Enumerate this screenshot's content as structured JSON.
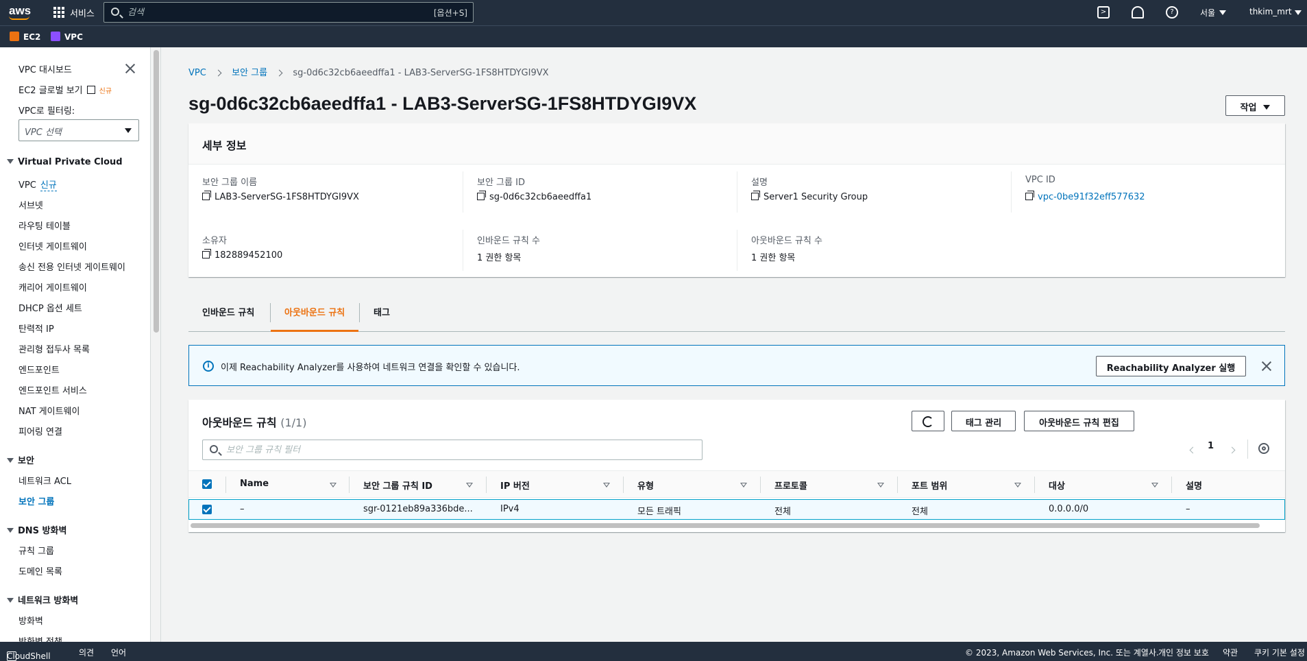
{
  "topbar": {
    "logo": "aws",
    "services_label": "서비스",
    "search_placeholder": "검색",
    "search_shortcut": "[옵션+S]",
    "region": "서울",
    "user": "thkim_mrt"
  },
  "favorites": [
    {
      "label": "EC2",
      "color": "#ec7211"
    },
    {
      "label": "VPC",
      "color": "#8c4fff"
    }
  ],
  "sidebar": {
    "dashboard": "VPC 대시보드",
    "ec2_global": "EC2 글로벌 보기",
    "new_badge": "신규",
    "filter_label": "VPC로 필터링:",
    "vpc_select_placeholder": "VPC 선택",
    "sections": [
      {
        "title": "Virtual Private Cloud",
        "items": [
          "VPC",
          "서브넷",
          "라우팅 테이블",
          "인터넷 게이트웨이",
          "송신 전용 인터넷 게이트웨이",
          "캐리어 게이트웨이",
          "DHCP 옵션 세트",
          "탄력적 IP",
          "관리형 접두사 목록",
          "엔드포인트",
          "엔드포인트 서비스",
          "NAT 게이트웨이",
          "피어링 연결"
        ]
      },
      {
        "title": "보안",
        "items": [
          "네트워크 ACL",
          "보안 그룹"
        ]
      },
      {
        "title": "DNS 방화벽",
        "items": [
          "규칙 그룹",
          "도메인 목록"
        ]
      },
      {
        "title": "네트워크 방화벽",
        "items": [
          "방화벽",
          "방화벽 정책"
        ]
      }
    ],
    "vpc_new": "신규"
  },
  "breadcrumb": [
    "VPC",
    "보안 그룹",
    "sg-0d6c32cb6aeedffa1 - LAB3-ServerSG-1FS8HTDYGI9VX"
  ],
  "page_title": "sg-0d6c32cb6aeedffa1 - LAB3-ServerSG-1FS8HTDYGI9VX",
  "actions_button": "작업",
  "details": {
    "header": "세부 정보",
    "fields": [
      {
        "label": "보안 그룹 이름",
        "value": "LAB3-ServerSG-1FS8HTDYGI9VX"
      },
      {
        "label": "보안 그룹 ID",
        "value": "sg-0d6c32cb6aeedffa1"
      },
      {
        "label": "설명",
        "value": "Server1 Security Group"
      },
      {
        "label": "VPC ID",
        "value": "vpc-0be91f32eff577632"
      },
      {
        "label": "소유자",
        "value": "182889452100"
      },
      {
        "label": "인바운드 규칙 수",
        "value": "1 권한 항목"
      },
      {
        "label": "아웃바운드 규칙 수",
        "value": "1 권한 항목"
      }
    ]
  },
  "tabs": [
    "인바운드 규칙",
    "아웃바운드 규칙",
    "태그"
  ],
  "info_banner": {
    "text": "이제 Reachability Analyzer를 사용하여 네트워크 연결을 확인할 수 있습니다.",
    "button": "Reachability Analyzer 실행"
  },
  "rules": {
    "title": "아웃바운드 규칙",
    "count": "(1/1)",
    "manage_tags": "태그 관리",
    "edit_button": "아웃바운드 규칙 편집",
    "filter_placeholder": "보안 그룹 규칙 필터",
    "page": "1",
    "columns": [
      "Name",
      "보안 그룹 규칙 ID",
      "IP 버전",
      "유형",
      "프로토콜",
      "포트 범위",
      "대상",
      "설명"
    ],
    "rows": [
      [
        "–",
        "sgr-0121eb89a336bde...",
        "IPv4",
        "모든 트래픽",
        "전체",
        "전체",
        "0.0.0.0/0",
        "–"
      ]
    ]
  },
  "footer": {
    "cloudshell": "CloudShell",
    "feedback": "의견",
    "language": "언어",
    "copyright": "© 2023, Amazon Web Services, Inc. 또는 계열사.",
    "privacy": "개인 정보 보호",
    "terms": "약관",
    "cookies": "쿠키 기본 설정"
  }
}
